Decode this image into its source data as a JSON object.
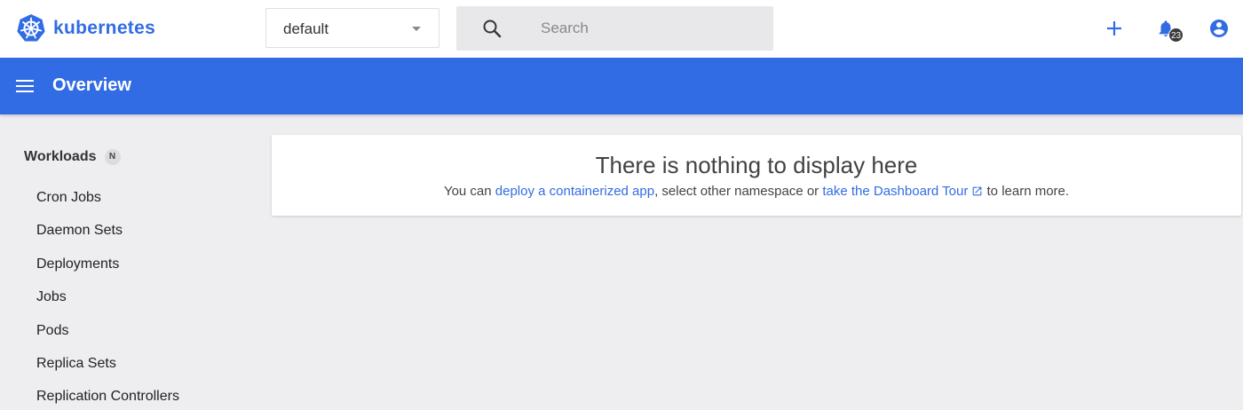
{
  "brand": {
    "name": "kubernetes",
    "logo_icon": "kubernetes-helm-icon",
    "color": "#326ce5"
  },
  "namespace": {
    "selected": "default"
  },
  "search": {
    "placeholder": "Search"
  },
  "toolbar": {
    "create_icon": "plus-icon",
    "notifications_icon": "bell-icon",
    "notifications_count": "23",
    "account_icon": "account-circle-icon"
  },
  "titlebar": {
    "title": "Overview",
    "color": "#326ce5"
  },
  "sidebar": {
    "section": {
      "label": "Workloads",
      "badge": "N"
    },
    "items": [
      {
        "label": "Cron Jobs"
      },
      {
        "label": "Daemon Sets"
      },
      {
        "label": "Deployments"
      },
      {
        "label": "Jobs"
      },
      {
        "label": "Pods"
      },
      {
        "label": "Replica Sets"
      },
      {
        "label": "Replication Controllers"
      }
    ]
  },
  "empty_state": {
    "title": "There is nothing to display here",
    "prefix": "You can ",
    "link1": "deploy a containerized app",
    "middle": ", select other namespace or ",
    "link2": "take the Dashboard Tour",
    "suffix": " to learn more."
  }
}
